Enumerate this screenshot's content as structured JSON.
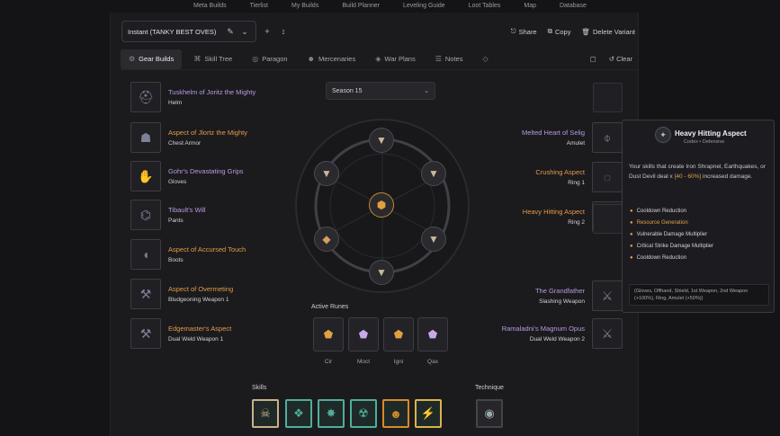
{
  "topnav": [
    "Meta Builds",
    "Tierlist",
    "My Builds",
    "Build Planner",
    "Leveling Guide",
    "Loot Tables",
    "Map",
    "Database"
  ],
  "variant": {
    "name": "Instant (TANKY BEST OVES)"
  },
  "toolbar": {
    "share": "Share",
    "copy": "Copy",
    "delete": "Delete Variant"
  },
  "tabs": [
    {
      "label": "Gear Builds",
      "icon": "gear-icon"
    },
    {
      "label": "Skill Tree",
      "icon": "tree-icon"
    },
    {
      "label": "Paragon",
      "icon": "paragon-icon"
    },
    {
      "label": "Mercenaries",
      "icon": "mercenary-icon"
    },
    {
      "label": "War Plans",
      "icon": "warplan-icon"
    },
    {
      "label": "Notes",
      "icon": "notes-icon"
    }
  ],
  "clear_label": "Clear",
  "season": "Season 15",
  "left_slots": [
    {
      "name": "Tuskhelm of Joritz the Mighty",
      "type": "Helm",
      "color": "purple",
      "icon": "helm-icon"
    },
    {
      "name": "Aspect of Jlortz the Mighty",
      "type": "Chest Armor",
      "color": "orange",
      "icon": "chest-icon"
    },
    {
      "name": "Gohr's Devastating Grips",
      "type": "Gloves",
      "color": "purple",
      "icon": "gloves-icon"
    },
    {
      "name": "Tibault's Will",
      "type": "Pants",
      "color": "purple",
      "icon": "pants-icon"
    },
    {
      "name": "Aspect of Accursed Touch",
      "type": "Boots",
      "color": "orange",
      "icon": "boots-icon"
    },
    {
      "name": "Aspect of Overmeting",
      "type": "Bludgeoning Weapon 1",
      "color": "orange",
      "icon": "weapon-icon"
    },
    {
      "name": "Edgemaster's Aspect",
      "type": "Dual Weld Weapon 1",
      "color": "orange",
      "icon": "weapon-icon"
    }
  ],
  "right_slots": [
    {
      "name": "Melted Heart of Selig",
      "type": "Amulet",
      "color": "purple",
      "icon": "amulet-icon"
    },
    {
      "name": "Crushing Aspect",
      "type": "Ring 1",
      "color": "orange",
      "icon": "ring-icon"
    },
    {
      "name": "Heavy Hitting Aspect",
      "type": "Ring 2",
      "color": "orange",
      "icon": "ring-icon"
    },
    {
      "name": "The Grandfather",
      "type": "Slashing Weapon",
      "color": "purple",
      "icon": "sword-icon"
    },
    {
      "name": "Ramaladni's Magnum Opus",
      "type": "Dual Weld Weapon 2",
      "color": "purple",
      "icon": "sword-icon"
    }
  ],
  "runes": {
    "label": "Active Runes",
    "items": [
      {
        "name": "Cir",
        "icon": "rune-icon"
      },
      {
        "name": "Moct",
        "icon": "rune-icon"
      },
      {
        "name": "Igni",
        "icon": "rune-icon"
      },
      {
        "name": "Qax",
        "icon": "rune-icon"
      }
    ]
  },
  "skills": {
    "label": "Skills",
    "colors": [
      "#c8b28a",
      "#4fae9c",
      "#4fae9c",
      "#4fae9c",
      "#d8892a",
      "#d8b44a"
    ]
  },
  "technique": {
    "label": "Technique"
  },
  "tooltip": {
    "title": "Heavy Hitting Aspect",
    "subtitle": "Codex • Defensive",
    "desc_a": "Your skills that create Iron Shrapnel, Earthquakes, or Dust Devil deal x",
    "desc_hl": "[40 - 60%]",
    "desc_b": " increased damage.",
    "stats": [
      {
        "text": "Cooldown Reduction",
        "hi": false
      },
      {
        "text": "Resource Generation",
        "hi": true
      },
      {
        "text": "Vulnerable Damage Multiplier",
        "hi": false
      },
      {
        "text": "Critical Strike Damage Multiplier",
        "hi": false
      },
      {
        "text": "Cooldown Reduction",
        "hi": false
      }
    ],
    "footer": "(Gloves, Offhand, Shield, 1st Weapon, 2nd Weapon (+100%), Ring, Amulet (+50%))"
  }
}
